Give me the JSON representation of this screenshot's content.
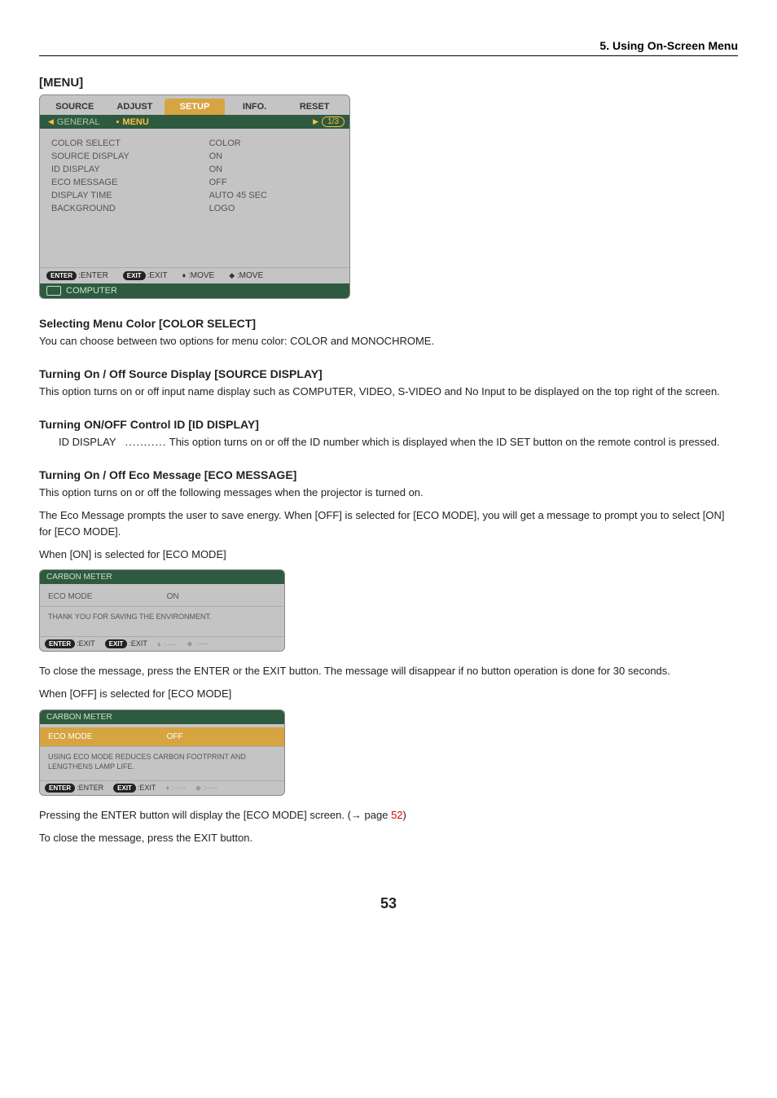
{
  "header": {
    "section": "5. Using On-Screen Menu"
  },
  "headings": {
    "menu": "[MENU]",
    "colorSelect": "Selecting Menu Color [COLOR SELECT]",
    "sourceDisplay": "Turning On / Off Source Display [SOURCE DISPLAY]",
    "idDisplay": "Turning ON/OFF Control ID [ID DISPLAY]",
    "ecoMessage": "Turning On / Off Eco Message [ECO MESSAGE]"
  },
  "body": {
    "colorSelect": "You can choose between two options for menu color: COLOR and MONOCHROME.",
    "sourceDisplay": "This option turns on or off input name display such as COMPUTER, VIDEO, S-VIDEO and No Input to be displayed on the top right of the screen.",
    "idDisplay": {
      "term": "ID DISPLAY",
      "dots": "...........",
      "desc": "This option turns on or off the ID number which is displayed when the ID SET button on the remote control is pressed."
    },
    "ecoMessage": {
      "p1": "This option turns on or off the following messages when the projector is turned on.",
      "p2": "The Eco Message prompts the user to save energy. When [OFF] is selected for [ECO MODE], you will get a message to prompt you to select [ON] for [ECO MODE].",
      "whenOn": "When [ON] is selected for [ECO MODE]",
      "afterOn": "To close the message, press the ENTER or the EXIT button. The message will disappear if no button operation is done for 30 seconds.",
      "whenOff": "When [OFF] is selected for [ECO MODE]",
      "afterOff1a": "Pressing the ENTER button will display the [ECO MODE] screen. (",
      "afterOff1b": " page ",
      "afterOff1page": "52",
      "afterOff1c": ")",
      "afterOff2": "To close the message, press the EXIT button."
    }
  },
  "osdBig": {
    "tabs": [
      "SOURCE",
      "ADJUST",
      "SETUP",
      "INFO.",
      "RESET"
    ],
    "activeTab": "SETUP",
    "subLeft": "GENERAL",
    "subCenter": "MENU",
    "page": "1/3",
    "rows": [
      {
        "label": "COLOR SELECT",
        "value": "COLOR"
      },
      {
        "label": "SOURCE DISPLAY",
        "value": "ON"
      },
      {
        "label": "ID DISPLAY",
        "value": "ON"
      },
      {
        "label": "ECO MESSAGE",
        "value": "OFF"
      },
      {
        "label": "DISPLAY TIME",
        "value": "AUTO 45 SEC"
      },
      {
        "label": "BACKGROUND",
        "value": "LOGO"
      }
    ],
    "footer": {
      "enter": ":ENTER",
      "exit": ":EXIT",
      "move1": ":MOVE",
      "move2": ":MOVE"
    },
    "status": "COMPUTER"
  },
  "osdOn": {
    "title": "CARBON METER",
    "row": {
      "label": "ECO MODE",
      "value": "ON"
    },
    "text": "THANK YOU FOR SAVING THE ENVIRONMENT.",
    "footer": {
      "enter": ":EXIT",
      "exit": ":EXIT",
      "dash": ":-----"
    }
  },
  "osdOff": {
    "title": "CARBON METER",
    "row": {
      "label": "ECO MODE",
      "value": "OFF"
    },
    "text": "USING ECO MODE REDUCES CARBON FOOTPRINT AND LENGTHENS LAMP LIFE.",
    "footer": {
      "enter": ":ENTER",
      "exit": ":EXIT",
      "dash": ":-----"
    }
  },
  "pageNumber": "53",
  "glyphs": {
    "arrowRight": "→",
    "triL": "◀",
    "triR": "▶",
    "ud": "▲▼",
    "lr": "◀▶",
    "dot": "▪"
  }
}
